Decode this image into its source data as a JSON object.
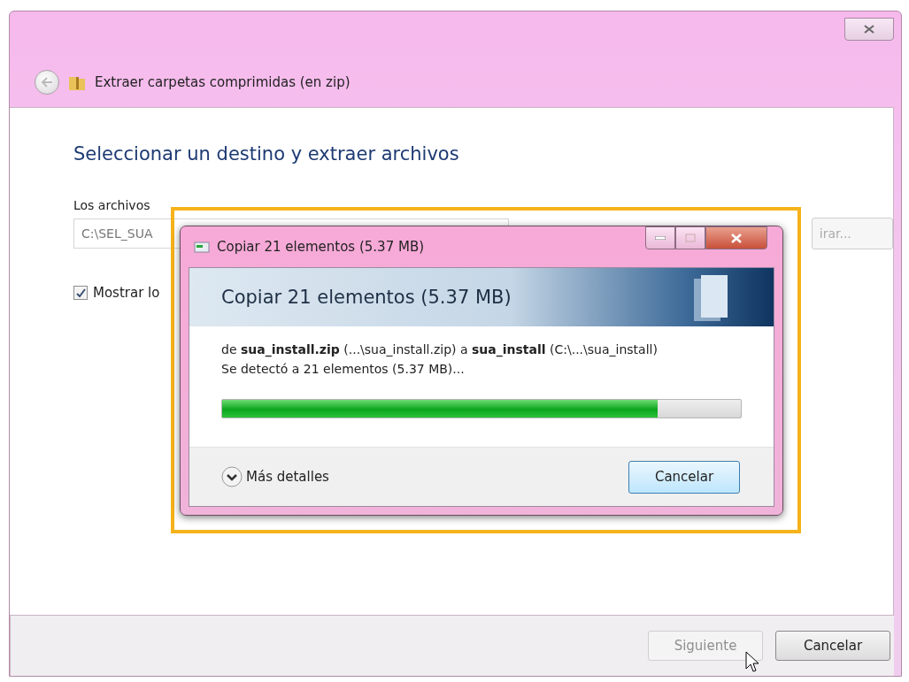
{
  "window": {
    "title": "Extraer carpetas comprimidas (en zip)"
  },
  "heading": "Seleccionar un destino y extraer archivos",
  "destination": {
    "label": "Los archivos",
    "value": "C:\\SEL_SUA",
    "browse_button": "irar..."
  },
  "show_files": {
    "label": "Mostrar lo",
    "checked": true
  },
  "footer_buttons": [
    {
      "label": "Siguiente",
      "disabled": true
    },
    {
      "label": "Cancelar",
      "disabled": false
    }
  ],
  "copy_dialog": {
    "title": "Copiar 21 elementos (5.37 MB)",
    "header": "Copiar 21 elementos (5.37 MB)",
    "from_line": "de **sua_install.zip** (...\\sua_install.zip) a **sua_install** (C:\\...\\sua_install)",
    "status": "Se detectó a 21 elementos (5.37 MB)...",
    "progress": {
      "level": 0.84
    },
    "details_toggle": {
      "label": "Más detalles",
      "expanded": false
    },
    "cancel_button": "Cancelar"
  }
}
